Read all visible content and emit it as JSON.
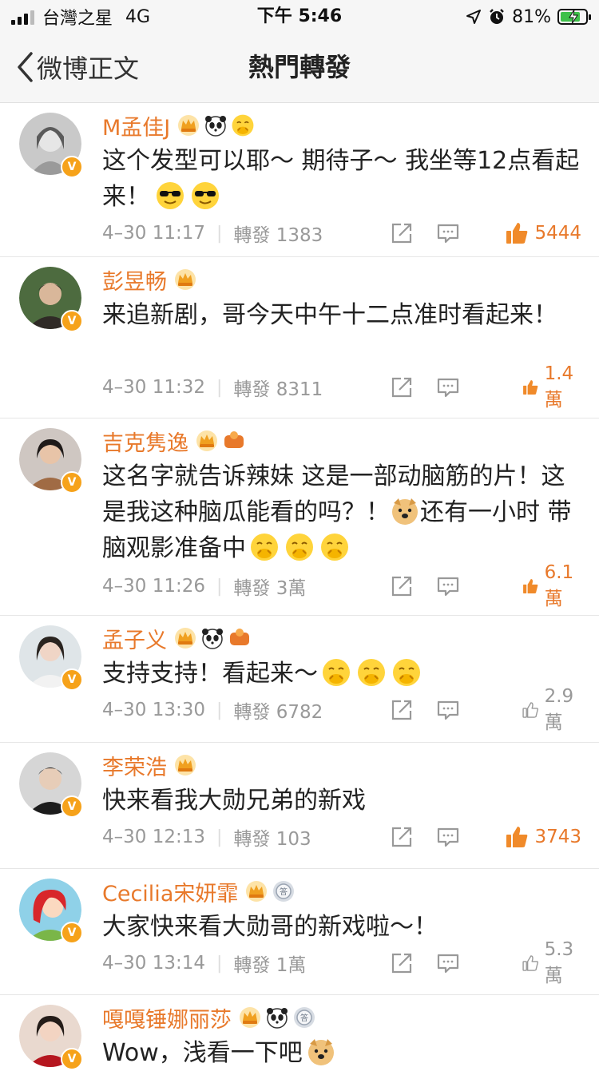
{
  "status_bar": {
    "carrier": "台灣之星",
    "network": "4G",
    "time": "下午 5:46",
    "battery": "81%",
    "battery_level": 0.81
  },
  "nav": {
    "back_label": "微博正文",
    "title": "熱門轉發"
  },
  "comments": [
    {
      "name": "M孟佳J",
      "text_a": "这个发型可以耶～ 期待子～ 我坐等12点看起来！",
      "time": "4–30 11:17",
      "reposts": "轉發 1383",
      "likes": "5444",
      "liked": true
    },
    {
      "name": "彭昱畅",
      "text_a": "来追新剧，哥今天中午十二点准时看起来！",
      "time": "4–30 11:32",
      "reposts": "轉發 8311",
      "likes": "1.4 萬",
      "liked": true
    },
    {
      "name": "吉克隽逸",
      "text_a": "这名字就告诉辣妹 这是一部动脑筋的片！这是我这种脑瓜能看的吗？！",
      "text_b": "还有一小时 带脑观影准备中",
      "time": "4–30 11:26",
      "reposts": "轉發 3萬",
      "likes": "6.1 萬",
      "liked": true
    },
    {
      "name": "孟子义",
      "text_a": "支持支持！看起来～",
      "time": "4–30 13:30",
      "reposts": "轉發 6782",
      "likes": "2.9 萬",
      "liked": false
    },
    {
      "name": "李荣浩",
      "text_a": "快来看我大勋兄弟的新戏",
      "time": "4–30 12:13",
      "reposts": "轉發 103",
      "likes": "3743",
      "liked": true
    },
    {
      "name": "Cecilia宋妍霏",
      "text_a": "大家快来看大勋哥的新戏啦～！",
      "time": "4–30 13:14",
      "reposts": "轉發 1萬",
      "likes": "5.3 萬",
      "liked": false
    },
    {
      "name": "嘎嘎锤娜丽莎",
      "text_a": "Wow，浅看一下吧"
    }
  ],
  "colors": {
    "name": "#e8792b",
    "meta": "#999999",
    "like_active": "#e8792b",
    "verified_badge": "#f6a21a"
  },
  "icons": [
    "back-chevron-icon",
    "share-icon",
    "comment-icon",
    "like-icon",
    "crown-icon",
    "panda-icon",
    "verified-icon",
    "emoji-icon"
  ]
}
